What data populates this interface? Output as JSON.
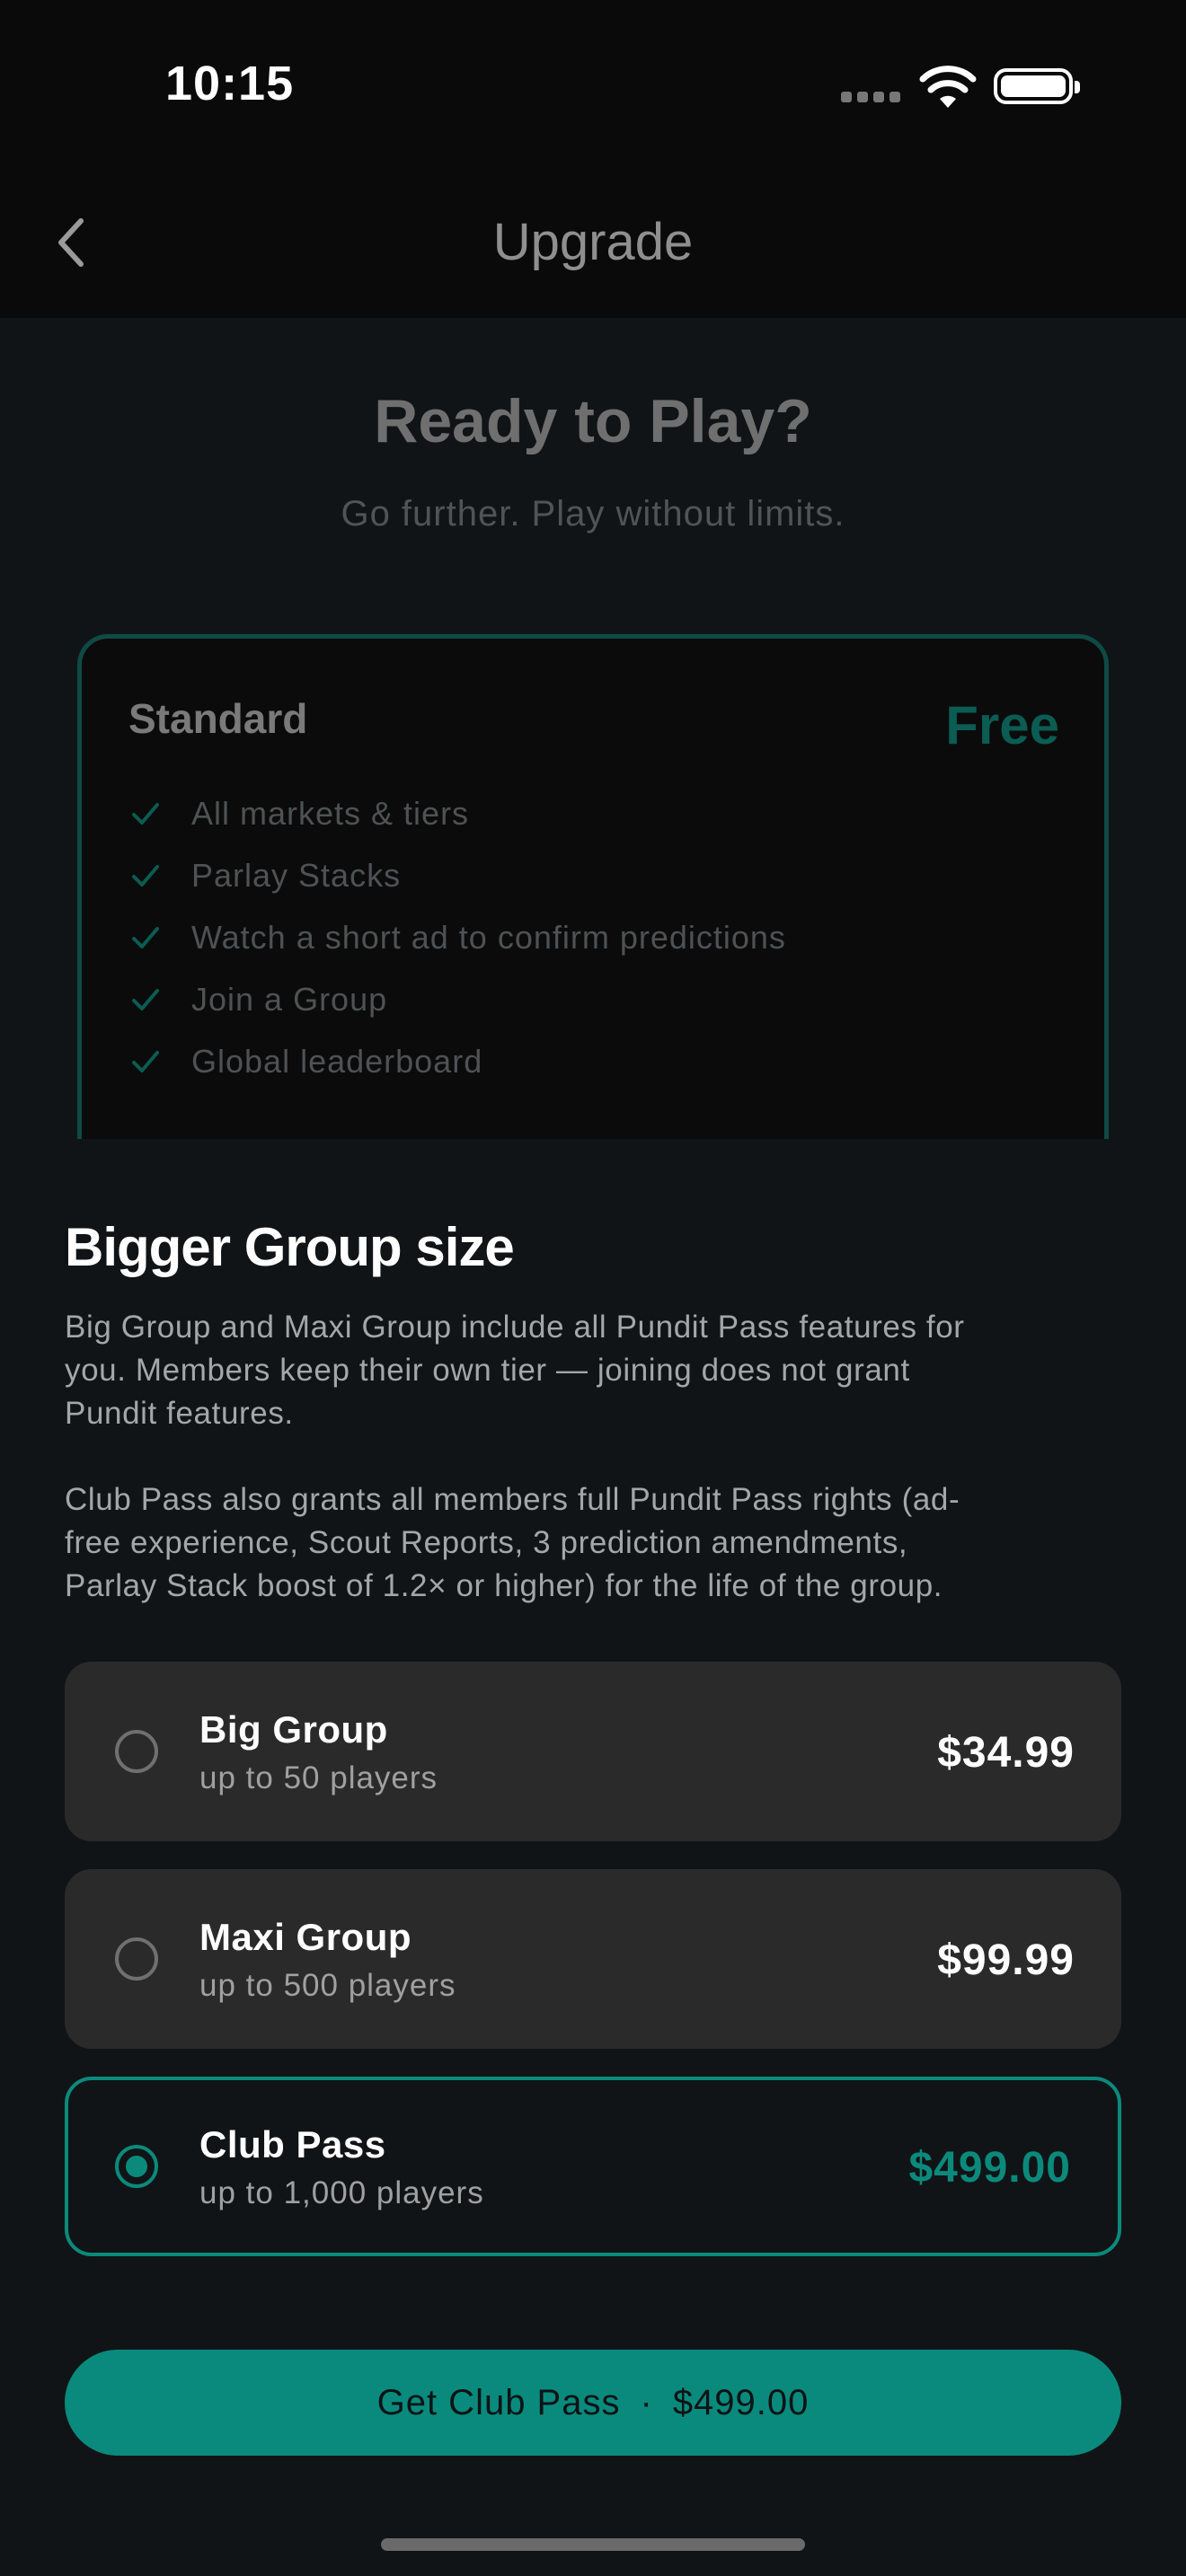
{
  "status_bar": {
    "time": "10:15"
  },
  "nav": {
    "title": "Upgrade"
  },
  "hero": {
    "title": "Ready to Play?",
    "subtitle": "Go further. Play without limits."
  },
  "standard_plan": {
    "name": "Standard",
    "price": "Free",
    "features": [
      "All markets & tiers",
      "Parlay Stacks",
      "Watch a short ad to confirm predictions",
      "Join a Group",
      "Global leaderboard"
    ]
  },
  "group_section": {
    "title": "Bigger Group size",
    "para1_lines": [
      "Big Group and Maxi Group include all Pundit Pass features for",
      "you. Members keep their own tier — joining does not grant",
      "Pundit features."
    ],
    "para2_lines": [
      "Club Pass also grants all members full Pundit Pass rights (ad-",
      "free experience, Scout Reports, 3 prediction amendments,",
      "Parlay Stack boost of 1.2× or higher) for the life of the group."
    ]
  },
  "options": [
    {
      "name": "Big Group",
      "subtitle": "up to 50 players",
      "price": "$34.99",
      "selected": false
    },
    {
      "name": "Maxi Group",
      "subtitle": "up to 500 players",
      "price": "$99.99",
      "selected": false
    },
    {
      "name": "Club Pass",
      "subtitle": "up to 1,000 players",
      "price": "$499.00",
      "selected": true
    }
  ],
  "cta": {
    "label": "Get Club Pass",
    "separator": "·",
    "price": "$499.00"
  },
  "colors": {
    "accent": "#0b8a7c",
    "background": "#111416",
    "card": "#2a2a2a"
  }
}
